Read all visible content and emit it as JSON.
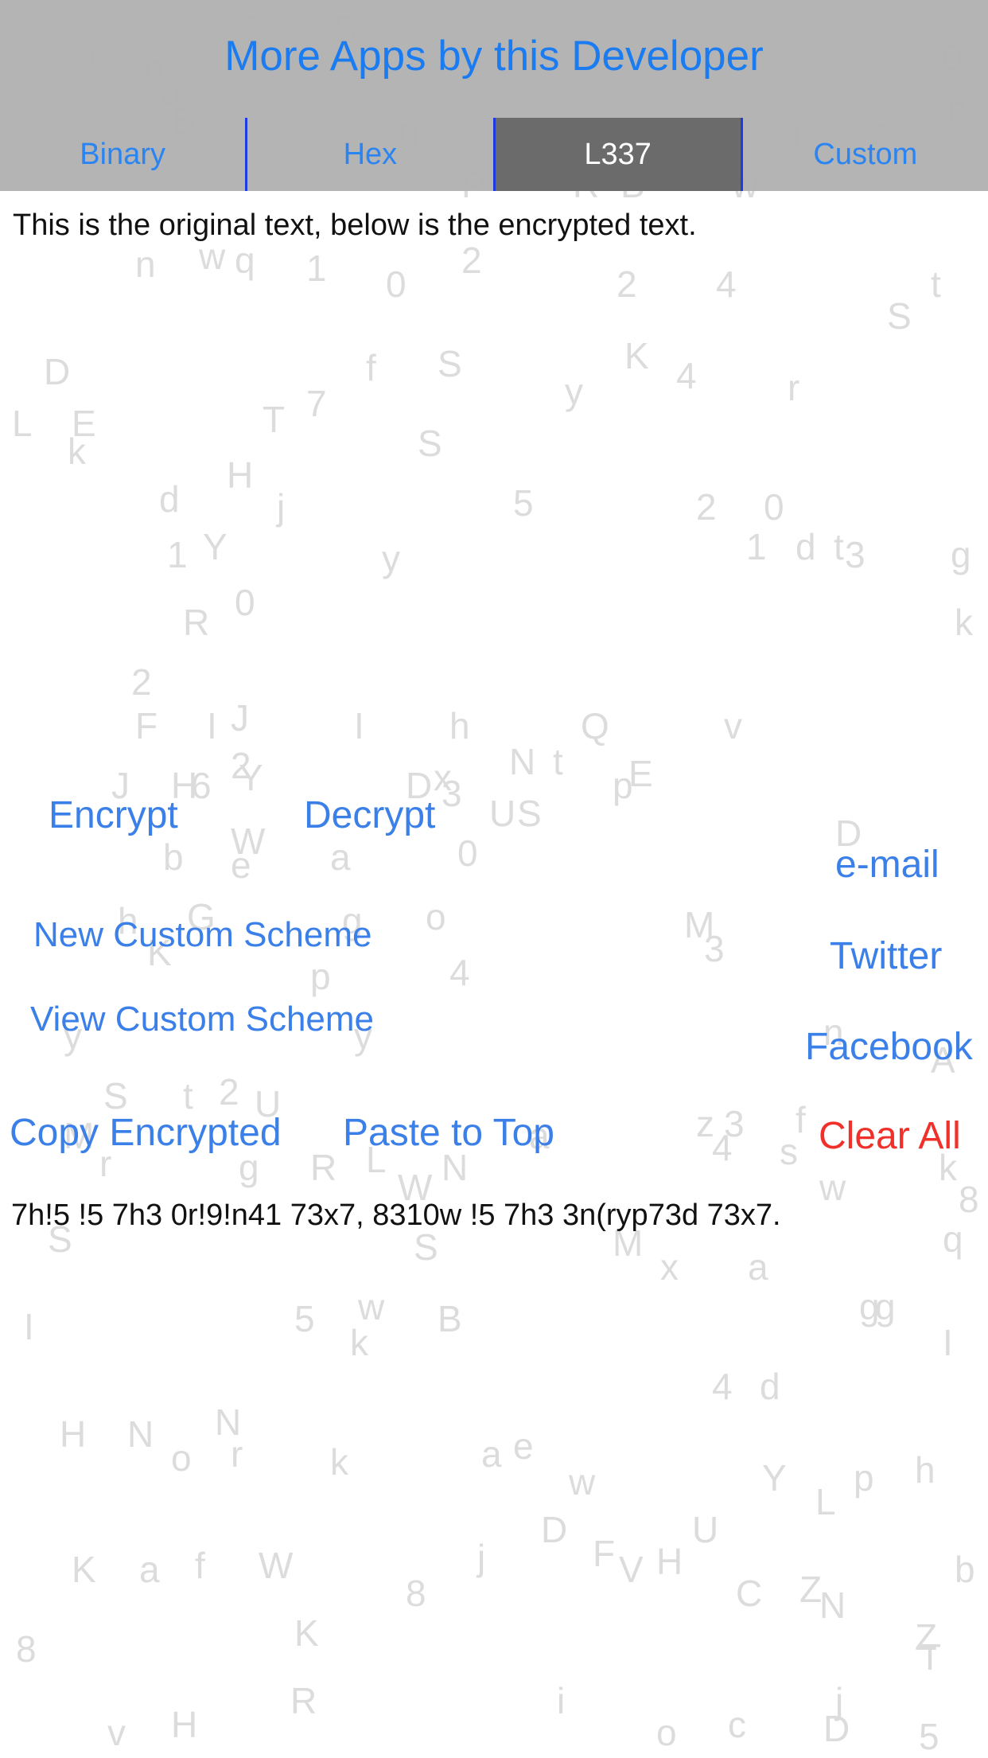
{
  "header": {
    "title": "More Apps by this Developer",
    "tabs": [
      "Binary",
      "Hex",
      "L337",
      "Custom"
    ],
    "selected_tab": "L337"
  },
  "original_text": "This is the original text, below is the encrypted text.",
  "encrypted_text": "7h!5 !5 7h3 0r!9!n41 73x7, 8310w !5 7h3 3n(ryp73d 73x7.",
  "buttons": {
    "encrypt": "Encrypt",
    "decrypt": "Decrypt",
    "new_scheme": "New Custom Scheme",
    "view_scheme": "View Custom Scheme",
    "copy_encrypted": "Copy Encrypted",
    "paste_to_top": "Paste to Top",
    "email": "e-mail",
    "twitter": "Twitter",
    "facebook": "Facebook",
    "clear_all": "Clear All"
  },
  "colors": {
    "accent": "#3b7fe8",
    "danger": "#f0302a",
    "header_bg": "#b2b2b2",
    "selected_tab_bg": "#6b6b6b",
    "tab_divider": "#1d3be0",
    "background_letters": "#dcdcdc"
  }
}
